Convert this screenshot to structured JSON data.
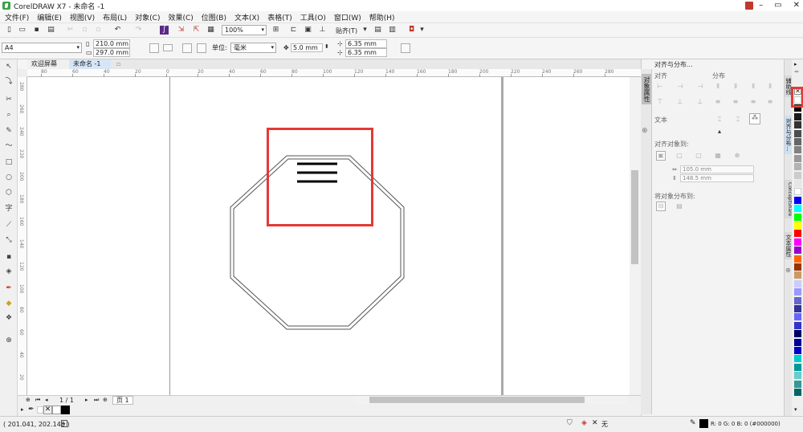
{
  "window": {
    "title": "CorelDRAW X7 - 未命名 -1",
    "min": "–",
    "restore": "▭",
    "close": "✕"
  },
  "menu": [
    "文件(F)",
    "编辑(E)",
    "视图(V)",
    "布局(L)",
    "对象(C)",
    "效果(C)",
    "位图(B)",
    "文本(X)",
    "表格(T)",
    "工具(O)",
    "窗口(W)",
    "帮助(H)"
  ],
  "toolbar": {
    "zoom": "100%",
    "snap": "贴齐(T)"
  },
  "property_bar": {
    "page_size": "A4",
    "width": "210.0 mm",
    "height": "297.0 mm",
    "units_label": "单位:",
    "units": "毫米",
    "nudge": "5.0 mm",
    "dup_x": "6.35 mm",
    "dup_y": "6.35 mm"
  },
  "tabs": {
    "welcome": "欢迎屏幕",
    "document": "未命名 -1"
  },
  "rulers": {
    "h": [
      "80",
      "60",
      "40",
      "20",
      "0",
      "20",
      "40",
      "60",
      "80",
      "100",
      "120",
      "140",
      "160",
      "180",
      "200",
      "220",
      "240",
      "260",
      "280"
    ],
    "v": [
      "280",
      "260",
      "240",
      "220",
      "200",
      "180",
      "160",
      "140",
      "120",
      "100",
      "80",
      "60",
      "40",
      "20"
    ]
  },
  "page_nav": {
    "page_count": "1 / 1",
    "page_tab": "页 1"
  },
  "status": {
    "coords": "( 201.041, 202.146 )",
    "fill": "无",
    "outline": "R: 0 G: 0 B: 0 (#000000)"
  },
  "docker": {
    "title": "对齐与分布...",
    "align": "对齐",
    "distribute": "分布",
    "text": "文本",
    "align_to": "对齐对象到:",
    "x": "105.0 mm",
    "y": "148.5 mm",
    "distribute_to": "将对象分布到:",
    "side_tabs": [
      "对象属性",
      "辅助线",
      "对齐与分布...",
      "ConceptShare",
      "文本属性"
    ]
  },
  "palette": [
    "#ffffff",
    "#000000",
    "#1a1a1a",
    "#333333",
    "#4d4d4d",
    "#666666",
    "#808080",
    "#999999",
    "#b3b3b3",
    "#cccccc",
    "#e6e6e6",
    "#ffffff",
    "#0000ff",
    "#00ffff",
    "#00ff00",
    "#ffff00",
    "#ff0000",
    "#ff00ff",
    "#9900cc",
    "#ff6600",
    "#993300",
    "#cc9966",
    "#ccccff",
    "#9999ff",
    "#6666cc",
    "#333399",
    "#6666ff",
    "#3333cc",
    "#000066",
    "#000099",
    "#0000cc",
    "#00cccc",
    "#009999",
    "#66cccc",
    "#339999",
    "#006666"
  ],
  "colors": {
    "highlight": "#e53935",
    "shape_outline": "#555555"
  }
}
